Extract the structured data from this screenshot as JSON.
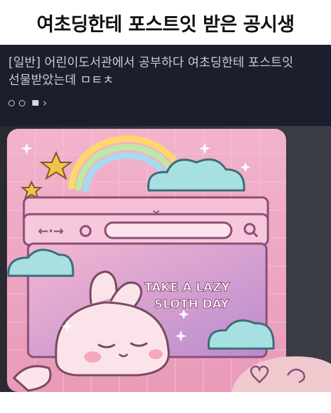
{
  "headline": {
    "text": "여초딩한테 포스트잇 받은 공시생"
  },
  "post": {
    "title": "[일반] 어린이도서관에서 공부하다 여초딩한테 포스트잇 선물받았는데 ㅁㅌㅊ"
  },
  "meta": {
    "chevron": "›"
  },
  "sticker": {
    "line1": "TAKE A LAZY",
    "line2": "SLOTH DAY"
  },
  "colors": {
    "panel_bg": "#1b1e2c",
    "text_light": "#c9ccd6",
    "pad_pink": "#efa9c4",
    "window_purple": "#c98fc7"
  }
}
